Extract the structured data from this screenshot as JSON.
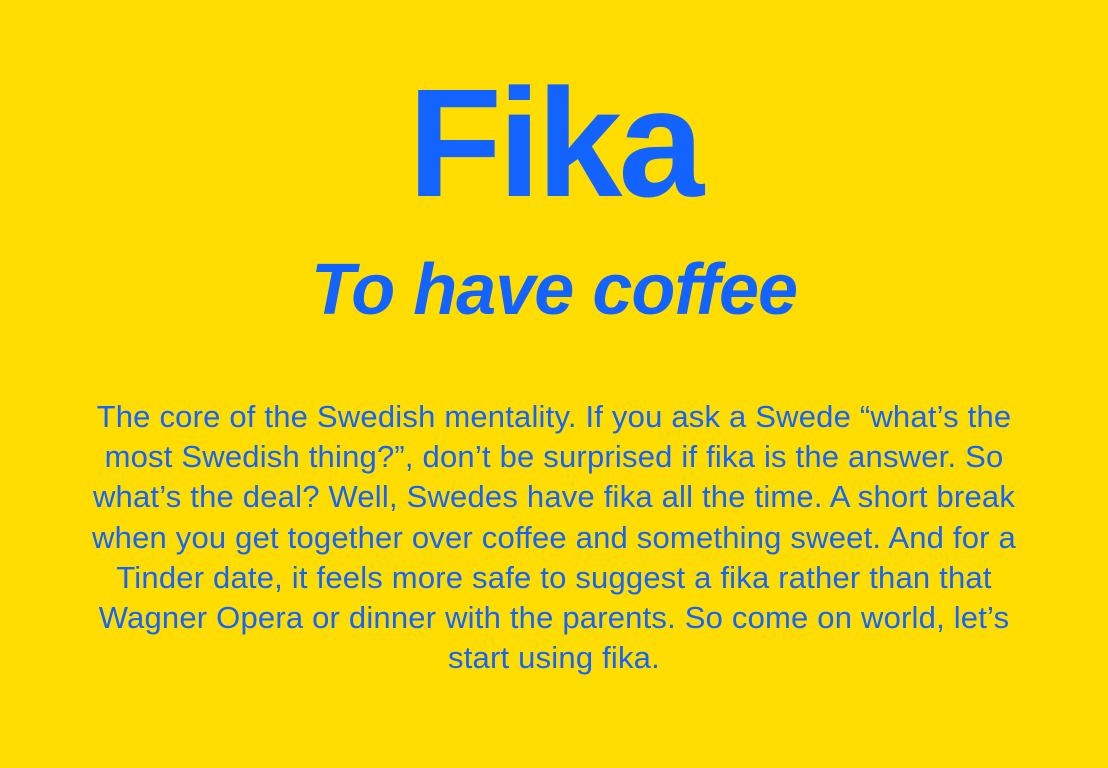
{
  "card": {
    "title": "Fika",
    "subtitle": "To have coffee",
    "body": "The core of the Swedish mentality. If you ask a Swede “what’s the most Swedish thing?”, don’t be surprised if fika is the answer. So what’s the deal? Well, Swedes have fika all the time. A short break when you get together over coffee and something sweet. And for a Tinder date, it feels more safe to suggest a fika rather than that Wagner Opera or dinner with the parents. So come on world, let’s start using fika."
  },
  "colors": {
    "background": "#FFDD00",
    "text": "#1263FF"
  }
}
